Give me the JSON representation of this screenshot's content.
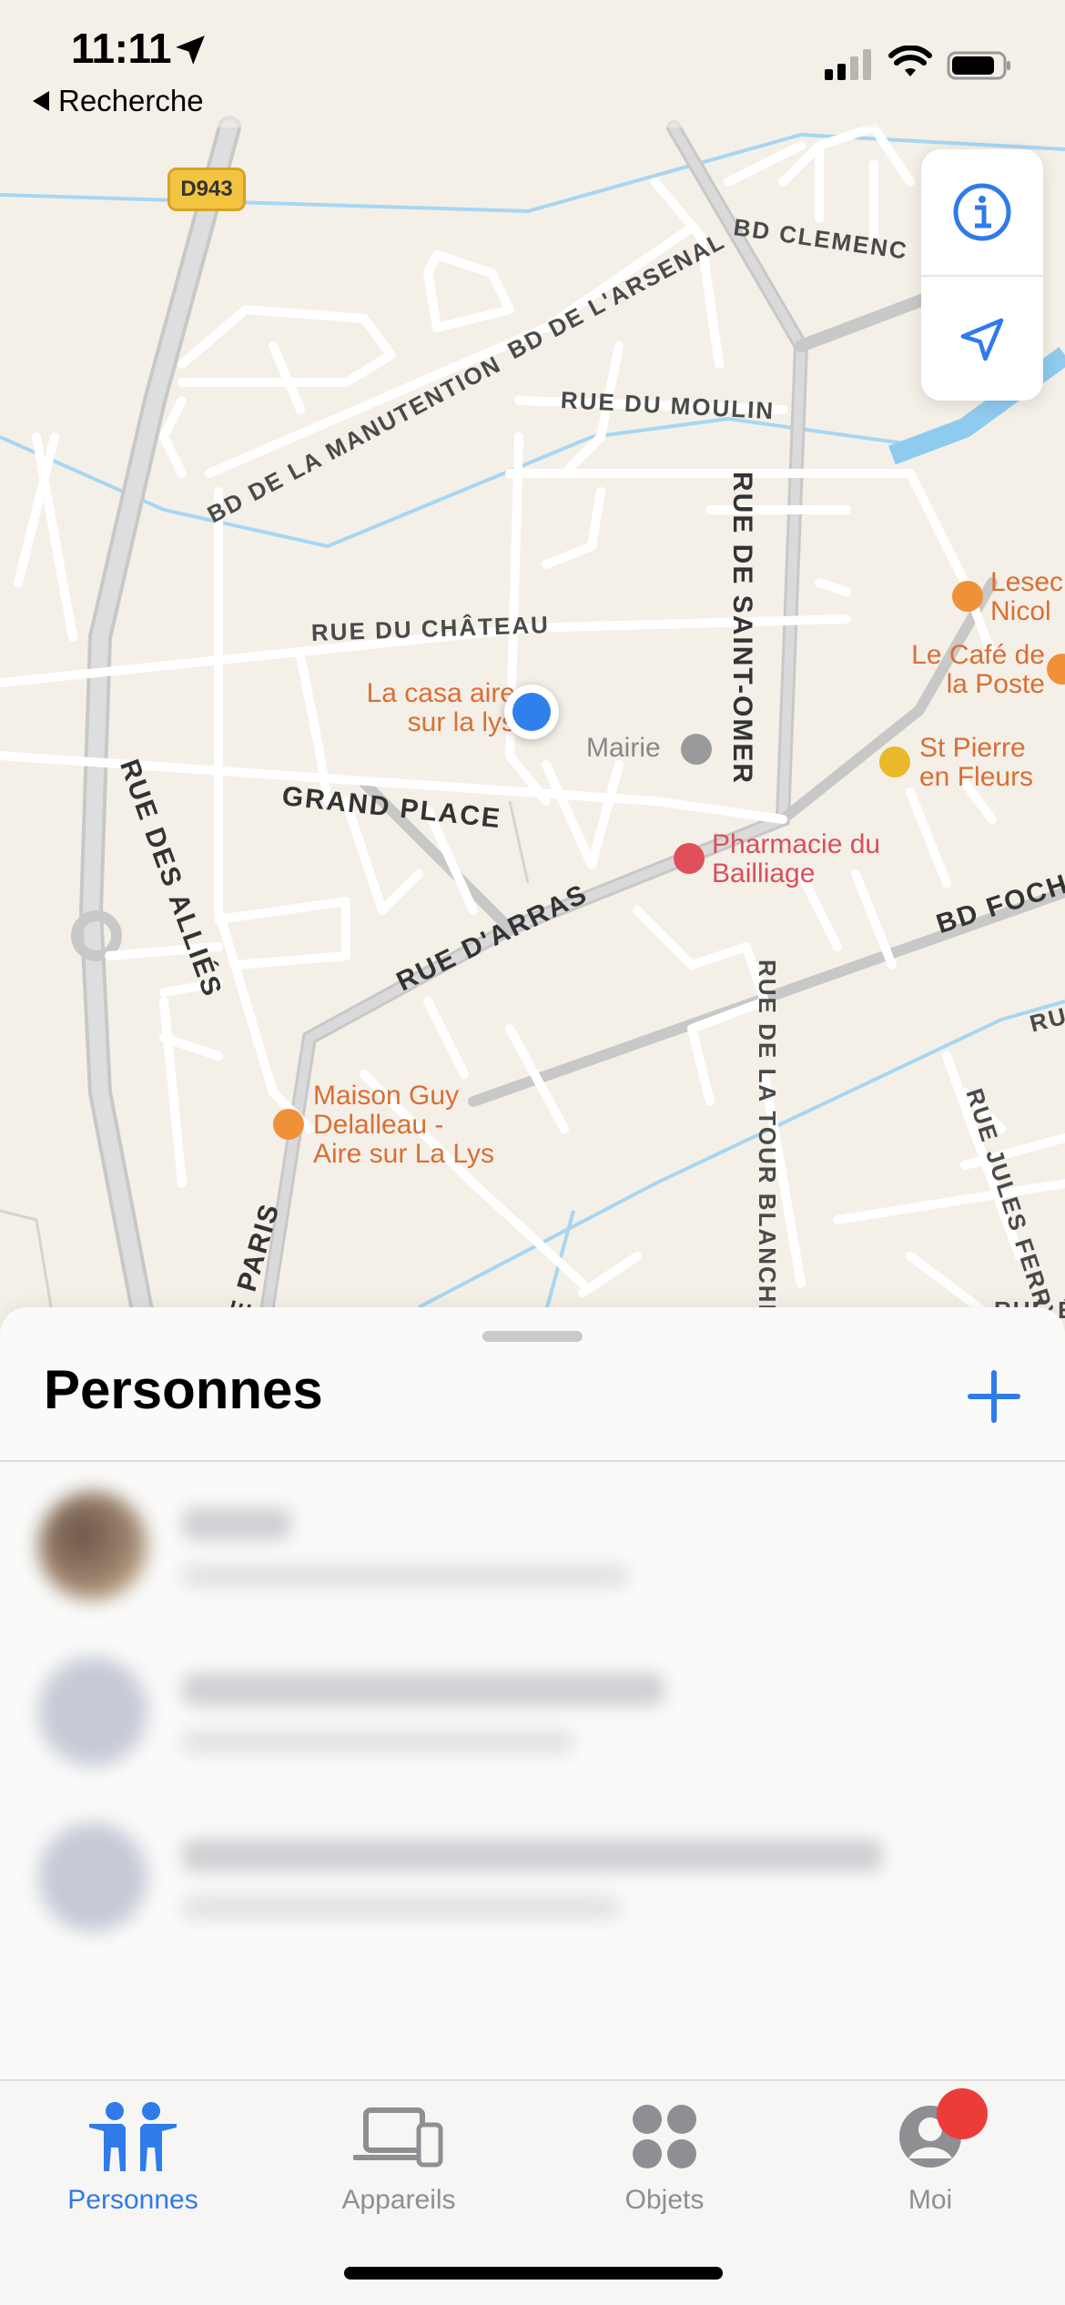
{
  "status": {
    "time": "11:11",
    "back_label": "Recherche",
    "icons": [
      "location-arrow-icon",
      "signal-icon",
      "wifi-icon",
      "battery-icon"
    ]
  },
  "map": {
    "road_badge": "D943",
    "streets": {
      "bd_clemenceau": "BD CLEMENC",
      "bd_arsenal": "BD DE L'ARSENAL",
      "bd_manutention": "BD DE LA MANUTENTION",
      "rue_moulin": "RUE DU MOULIN",
      "rue_saint_omer": "RUE DE SAINT-OMER",
      "rue_chateau": "RUE DU CHÂTEAU",
      "grand_place": "GRAND PLACE",
      "rue_allies": "RUE DES ALLIÉS",
      "rue_arras": "RUE D'ARRAS",
      "bd_foch": "BD FOCH",
      "rue_tour_blanche": "RUE DE LA TOUR BLANCHE",
      "rue_jules_ferry": "RUE JULES FERRY",
      "rue_paris": "E PARIS",
      "rue_right": "RU",
      "rue_bottom_right": "RUE É"
    },
    "pois": {
      "casa": "La casa aire\nsur la lys",
      "mairie": "Mairie",
      "pharmacie": "Pharmacie du\nBailliage",
      "lesec": "Lesec\nNicol",
      "cafe": "Le Café de\nla Poste",
      "st_pierre": "St Pierre\nen Fleurs",
      "maison_guy": "Maison Guy\nDelalleau -\nAire sur La Lys"
    },
    "controls": [
      "info-icon",
      "location-arrow-icon"
    ]
  },
  "sheet": {
    "title": "Personnes",
    "add_icon": "plus-icon"
  },
  "tabs": [
    {
      "label": "Personnes",
      "icon": "people-icon",
      "active": true
    },
    {
      "label": "Appareils",
      "icon": "devices-icon",
      "active": false
    },
    {
      "label": "Objets",
      "icon": "items-icon",
      "active": false
    },
    {
      "label": "Moi",
      "icon": "me-icon",
      "active": false
    }
  ],
  "colors": {
    "accent": "#2f7bea",
    "poi_orange": "#d96f35",
    "poi_red": "#d8505c",
    "water": "#9fd3f0",
    "badge": "#ec3c3a"
  }
}
